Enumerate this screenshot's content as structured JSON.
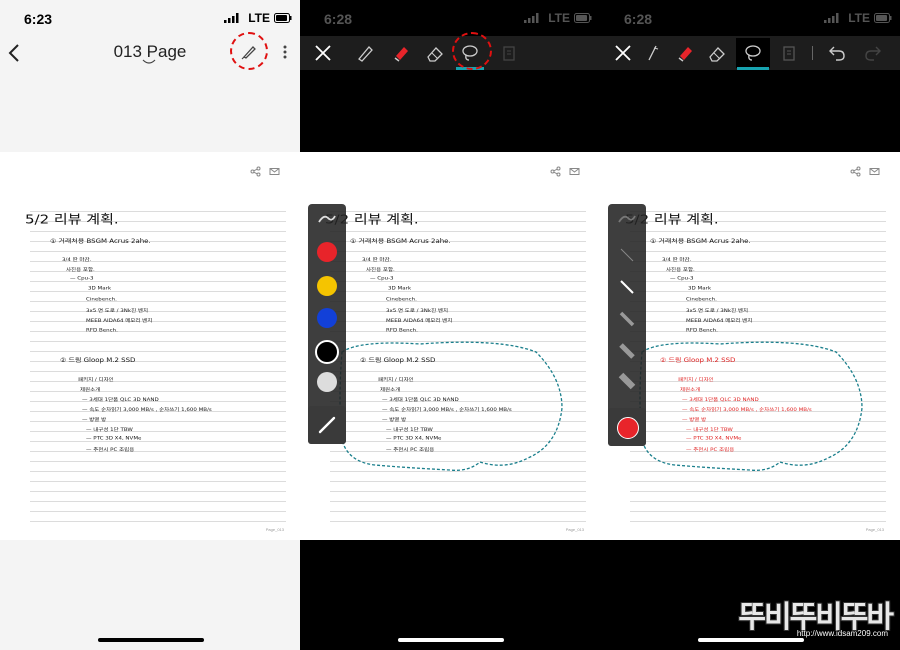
{
  "screens": [
    {
      "time": "6:23",
      "network": "LTE",
      "page_title": "013 Page"
    },
    {
      "time": "6:28",
      "network": "LTE"
    },
    {
      "time": "6:28",
      "network": "LTE"
    }
  ],
  "toolbar_icons": {
    "screen1": [
      "back-chevron-icon",
      "pen-edit-icon",
      "more-vertical-icon"
    ],
    "screen2": [
      "close-icon",
      "pen-icon",
      "highlighter-icon",
      "eraser-icon",
      "lasso-icon",
      "clipboard-icon"
    ],
    "screen3": [
      "close-icon",
      "pen-icon",
      "highlighter-icon",
      "eraser-icon",
      "lasso-icon",
      "clipboard-icon",
      "undo-icon",
      "redo-icon"
    ]
  },
  "colors": {
    "accent_underline": "#17a3b0",
    "highlight_ring": "#e01010",
    "selected_ink": "#e02020",
    "palette": [
      "#e8242a",
      "#f5c400",
      "#1240d8",
      "#000000",
      "#dddddd"
    ]
  },
  "note": {
    "heading": "5/2  리뷰 계획.",
    "section1": [
      "① 거래처용 BSGM Acrus 2ahe.",
      "3/4 딴 마감.",
      "사진용 포함.",
      "— Cpu-3",
      "3D Mark",
      "Cinebench.",
      "3x5 면 도로 / 3Nk진 벤치",
      "MEEB AIDA64 메모리 벤치",
      "RFD Bench."
    ],
    "section2": [
      "② 드림 Gloop M.2 SSD",
      "패키지 / 디자인",
      "제원소개",
      "— 3세대 1단품 QLC 3D NAND",
      "— 속도 순차읽기 3,000 MB/s , 순차쓰기 1,600 MB/s",
      "— 방열 방",
      "— 내구성 1단 TBW",
      "— PTC 3D X4, NVMe",
      "— 추천시 PC 조립용"
    ],
    "page_footer": "Page_013"
  },
  "watermark": {
    "title": "뚜비뚜비뚜바",
    "url": "http://www.idsam209.com"
  }
}
